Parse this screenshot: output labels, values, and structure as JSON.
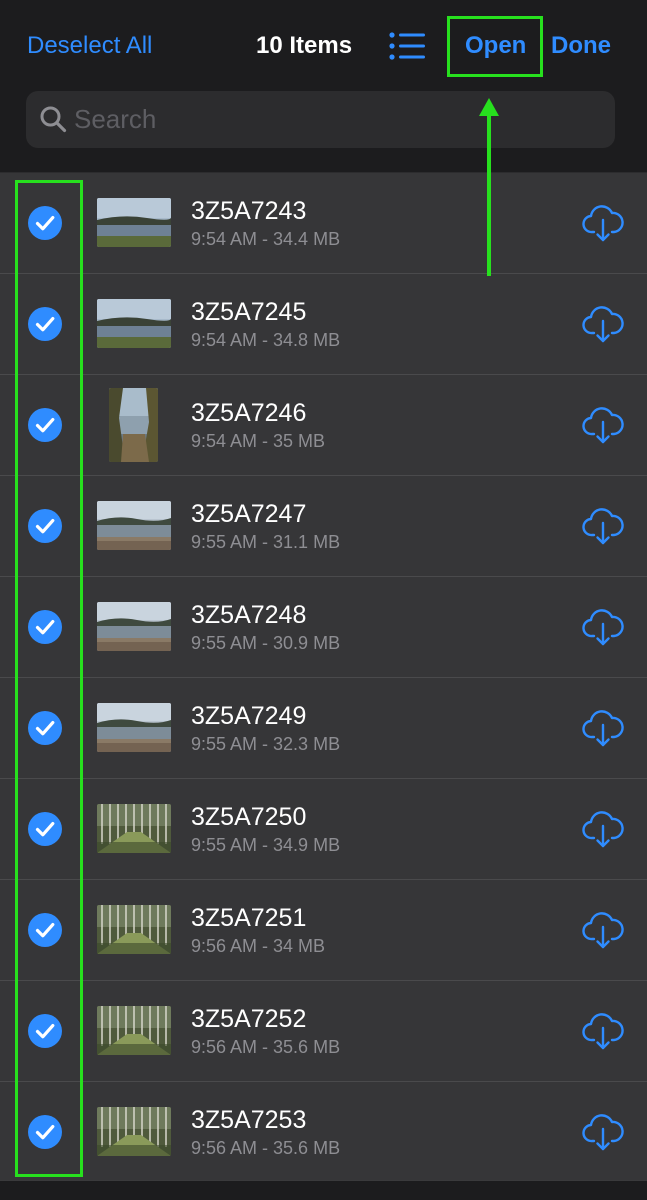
{
  "toolbar": {
    "deselect_label": "Deselect All",
    "title": "10 Items",
    "list_icon": "list-view-icon",
    "open_label": "Open",
    "done_label": "Done"
  },
  "search": {
    "placeholder": "Search",
    "value": "",
    "icon": "search-icon"
  },
  "colors": {
    "accent": "#2f8cff",
    "highlight": "#27e01e",
    "row_background": "#363638",
    "background": "#1c1c1e"
  },
  "files": [
    {
      "name": "3Z5A7243",
      "meta": "9:54 AM - 34.4 MB",
      "selected": true,
      "thumb": "lake-landscape",
      "action_icon": "cloud-download-icon"
    },
    {
      "name": "3Z5A7245",
      "meta": "9:54 AM - 34.8 MB",
      "selected": true,
      "thumb": "lake-landscape",
      "action_icon": "cloud-download-icon"
    },
    {
      "name": "3Z5A7246",
      "meta": "9:54 AM - 35 MB",
      "selected": true,
      "thumb": "lake-portrait",
      "action_icon": "cloud-download-icon"
    },
    {
      "name": "3Z5A7247",
      "meta": "9:55 AM - 31.1 MB",
      "selected": true,
      "thumb": "lake-shore",
      "action_icon": "cloud-download-icon"
    },
    {
      "name": "3Z5A7248",
      "meta": "9:55 AM - 30.9 MB",
      "selected": true,
      "thumb": "lake-shore",
      "action_icon": "cloud-download-icon"
    },
    {
      "name": "3Z5A7249",
      "meta": "9:55 AM - 32.3 MB",
      "selected": true,
      "thumb": "lake-shore",
      "action_icon": "cloud-download-icon"
    },
    {
      "name": "3Z5A7250",
      "meta": "9:55 AM - 34.9 MB",
      "selected": true,
      "thumb": "forest",
      "action_icon": "cloud-download-icon"
    },
    {
      "name": "3Z5A7251",
      "meta": "9:56 AM - 34 MB",
      "selected": true,
      "thumb": "forest",
      "action_icon": "cloud-download-icon"
    },
    {
      "name": "3Z5A7252",
      "meta": "9:56 AM - 35.6 MB",
      "selected": true,
      "thumb": "forest",
      "action_icon": "cloud-download-icon"
    },
    {
      "name": "3Z5A7253",
      "meta": "9:56 AM - 35.6 MB",
      "selected": true,
      "thumb": "forest",
      "action_icon": "cloud-download-icon"
    }
  ]
}
